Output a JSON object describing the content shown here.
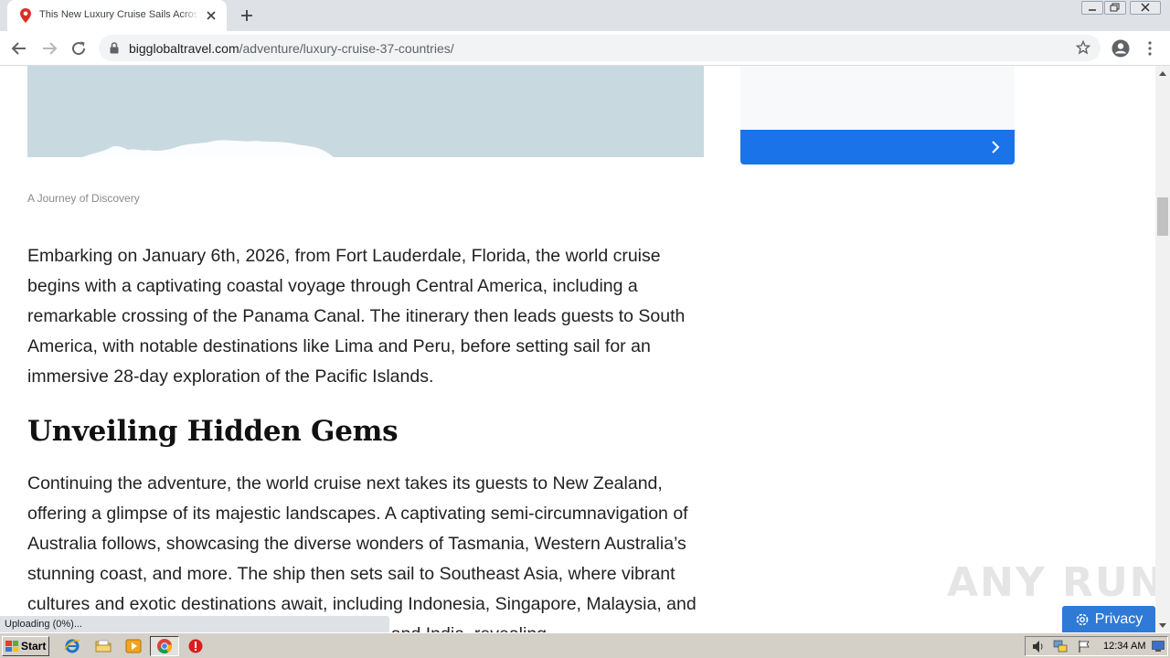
{
  "browser": {
    "tab_title": "This New Luxury Cruise Sails Across",
    "url_domain": "bigglobaltravel.com",
    "url_path": "/adventure/luxury-cruise-37-countries/",
    "status_text": "Uploading (0%)..."
  },
  "article": {
    "caption": "A Journey of Discovery",
    "paragraph1": "Embarking on January 6th, 2026, from Fort Lauderdale, Florida, the world cruise begins with a captivating coastal voyage through Central America, including a remarkable crossing of the Panama Canal. The itinerary then leads guests to South America, with notable destinations like Lima and Peru, before setting sail for an immersive 28-day exploration of the Pacific Islands.",
    "heading": "Unveiling Hidden Gems",
    "paragraph2": "Continuing the adventure, the world cruise next takes its guests to New Zealand, offering a glimpse of its majestic landscapes. A captivating semi-circumnavigation of Australia follows, showcasing the diverse wonders of Tasmania, Western Australia’s stunning coast, and more. The ship then sets sail to Southeast Asia, where vibrant cultures and exotic destinations await, including Indonesia, Singapore, Malaysia, and Thailand. Next, the voyage stops in Sri Lanka and India, revealing"
  },
  "overlay": {
    "watermark": "ANY RUN",
    "privacy_label": "Privacy"
  },
  "taskbar": {
    "start_label": "Start",
    "clock": "12:34 AM"
  },
  "colors": {
    "accent_blue": "#1a73e8",
    "privacy_blue": "#2e7ad6",
    "hero_sky": "#c8dadf"
  },
  "icons": [
    "map-pin-favicon-icon",
    "close-icon",
    "plus-icon",
    "back-icon",
    "forward-icon",
    "reload-icon",
    "lock-icon",
    "star-icon",
    "account-icon",
    "menu-icon",
    "chevron-right-icon",
    "gear-icon",
    "windows-flag-icon",
    "ie-icon",
    "folder-icon",
    "media-player-icon",
    "chrome-icon",
    "stop-icon",
    "speaker-icon",
    "network-icon",
    "flag-icon",
    "monitor-icon"
  ]
}
